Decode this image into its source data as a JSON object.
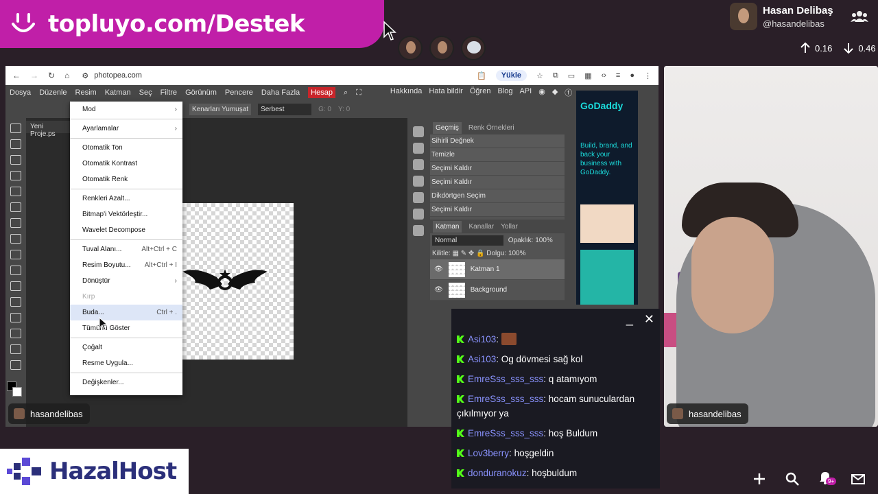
{
  "banner": {
    "text": "topluyo.com/Destek"
  },
  "profile": {
    "name": "Hasan Delibaş",
    "handle": "@hasandelibas"
  },
  "stats": {
    "up": "0.16",
    "down": "0.46"
  },
  "browser": {
    "url": "photopea.com",
    "upload_label": "Yükle"
  },
  "photopea": {
    "menu": [
      "Dosya",
      "Düzenle",
      "Resim",
      "Katman",
      "Seç",
      "Filtre",
      "Görünüm",
      "Pencere",
      "Daha Fazla"
    ],
    "hesap": "Hesap",
    "right_links": [
      "Hakkında",
      "Hata bildir",
      "Öğren",
      "Blog",
      "API"
    ],
    "options": {
      "smooth_btn": "Kenarları Yumuşat",
      "style_select": "Serbest",
      "g_label": "G: 0",
      "y_label": "Y: 0"
    },
    "doc_tab": "Yeni Proje.ps",
    "panel_tabs": {
      "history": "Geçmiş",
      "swatches": "Renk Örnekleri"
    },
    "history": [
      "Sihirli Değnek",
      "Temizle",
      "Seçimi Kaldır",
      "Seçimi Kaldır",
      "Dikdörtgen Seçim",
      "Seçimi Kaldır"
    ],
    "layer_tabs": {
      "layers": "Katman",
      "channels": "Kanallar",
      "paths": "Yollar"
    },
    "blend": "Normal",
    "opacity_label": "Opaklık:",
    "opacity": "100%",
    "lock_label": "Kilitle:",
    "fill_label": "Dolgu:",
    "fill": "100%",
    "layers": [
      "Katman 1",
      "Background"
    ]
  },
  "image_menu": {
    "items": [
      {
        "label": "Mod",
        "shortcut": "›"
      },
      {
        "label": "Ayarlamalar",
        "shortcut": "›"
      },
      {
        "label": "Otomatik Ton",
        "shortcut": ""
      },
      {
        "label": "Otomatik Kontrast",
        "shortcut": ""
      },
      {
        "label": "Otomatik Renk",
        "shortcut": ""
      },
      {
        "label": "Renkleri Azalt...",
        "shortcut": ""
      },
      {
        "label": "Bitmap'i Vektörleştir...",
        "shortcut": ""
      },
      {
        "label": "Wavelet Decompose",
        "shortcut": ""
      },
      {
        "label": "Tuval Alanı...",
        "shortcut": "Alt+Ctrl + C"
      },
      {
        "label": "Resim Boyutu...",
        "shortcut": "Alt+Ctrl + I"
      },
      {
        "label": "Dönüştür",
        "shortcut": "›"
      },
      {
        "label": "Kırp",
        "shortcut": ""
      },
      {
        "label": "Buda...",
        "shortcut": "Ctrl + ."
      },
      {
        "label": "Tümünü Göster",
        "shortcut": ""
      },
      {
        "label": "Çoğalt",
        "shortcut": ""
      },
      {
        "label": "Resme Uygula...",
        "shortcut": ""
      },
      {
        "label": "Değişkenler...",
        "shortcut": ""
      }
    ]
  },
  "ad": {
    "brand": "GoDaddy",
    "copy": "Build, brand, and back your business with GoDaddy."
  },
  "nametags": {
    "screen": "hasandelibas",
    "cam": "hasandelibas"
  },
  "chat": {
    "messages": [
      {
        "user": "Asi103",
        "text": ""
      },
      {
        "user": "Asi103",
        "text": "Og dövmesi sağ kol"
      },
      {
        "user": "EmreSss_sss_sss",
        "text": "q atamıyom"
      },
      {
        "user": "EmreSss_sss_sss",
        "text": "hocam sunuculardan çıkılmıyor ya"
      },
      {
        "user": "EmreSss_sss_sss",
        "text": "hoş Buldum"
      },
      {
        "user": "Lov3berry",
        "text": "hoşgeldin"
      },
      {
        "user": "donduranokuz",
        "text": "hoşbuldum"
      }
    ]
  },
  "logo": {
    "word": "HazalHost"
  },
  "notifications": {
    "count": "9+"
  }
}
